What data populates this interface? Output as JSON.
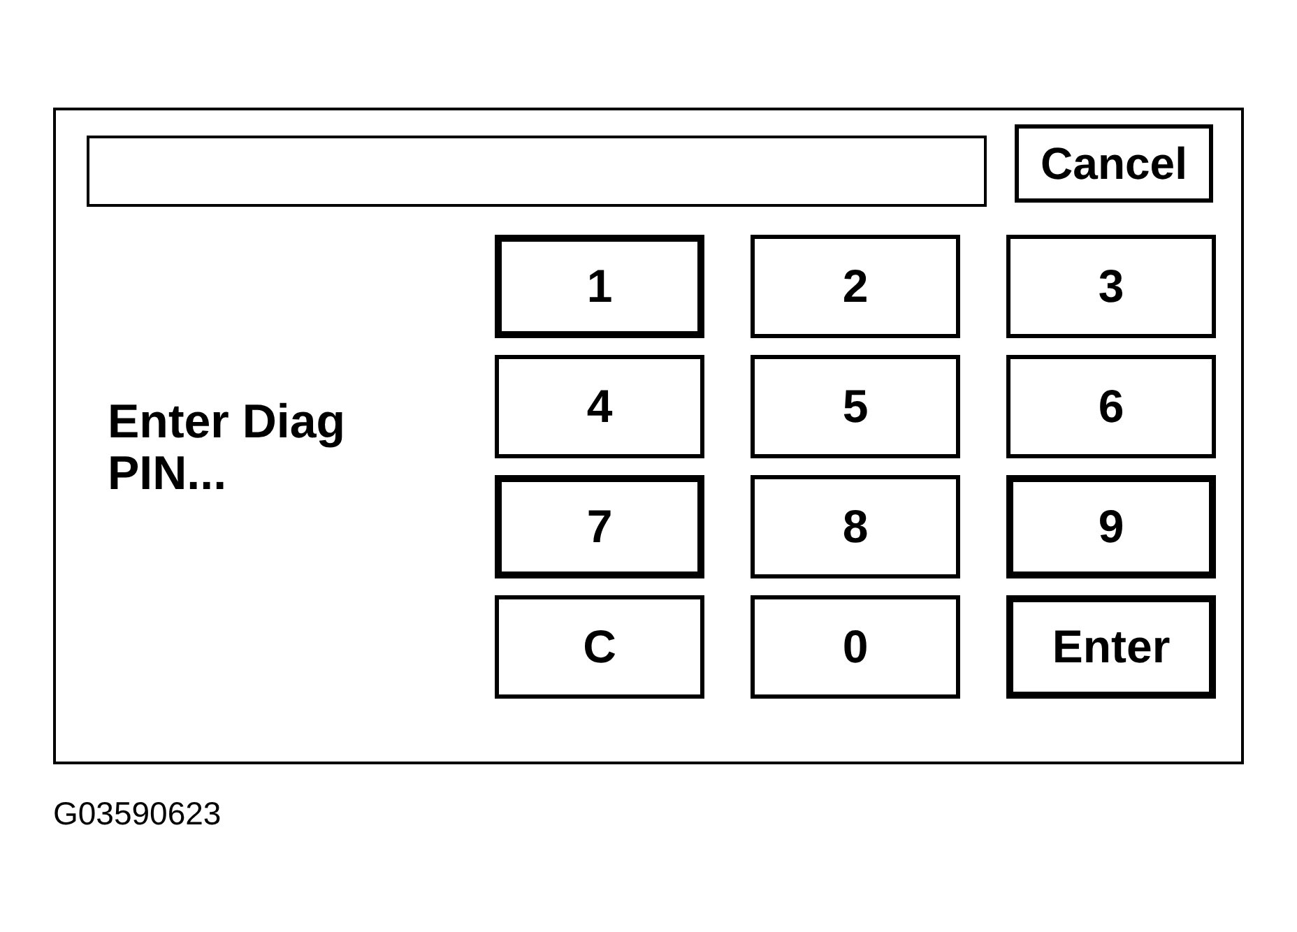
{
  "dialog": {
    "cancel_button": "Cancel",
    "prompt": "Enter Diag PIN...",
    "keys": [
      {
        "label": "1",
        "kind": "heavy"
      },
      {
        "label": "2",
        "kind": "plain"
      },
      {
        "label": "3",
        "kind": "plain"
      },
      {
        "label": "4",
        "kind": "plain"
      },
      {
        "label": "5",
        "kind": "plain"
      },
      {
        "label": "6",
        "kind": "plain"
      },
      {
        "label": "7",
        "kind": "heavy"
      },
      {
        "label": "8",
        "kind": "plain"
      },
      {
        "label": "9",
        "kind": "heavy"
      },
      {
        "label": "C",
        "kind": "plain"
      },
      {
        "label": "0",
        "kind": "plain"
      },
      {
        "label": "Enter",
        "kind": "heavy"
      }
    ]
  },
  "figure_number": "G03590623"
}
